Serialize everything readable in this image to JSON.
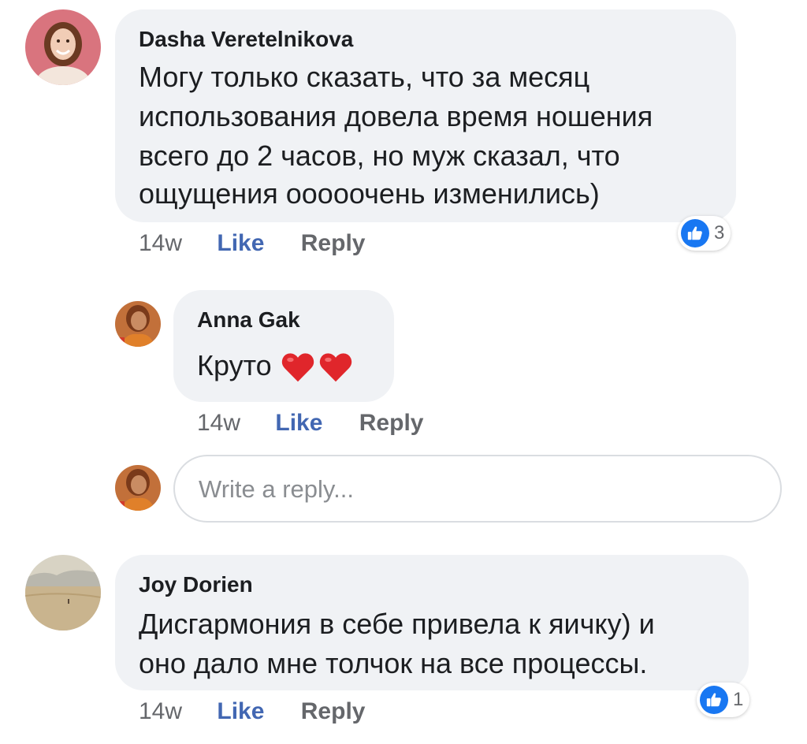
{
  "comments": [
    {
      "author": "Dasha Veretelnikova",
      "lines": [
        "Могу только сказать, что за месяц",
        "использования довела время ношения",
        "всего до 2 часов, но муж сказал, что",
        "ощущения ооооочень изменились)"
      ],
      "time": "14w",
      "like_label": "Like",
      "reply_label": "Reply",
      "reaction_icon": "thumbs-up-icon",
      "reaction_count": "3",
      "avatar_colors": {
        "bg": "#d9747e",
        "skin": "#f1cdb6",
        "hair": "#6b3a22"
      }
    },
    {
      "author": "Anna Gak",
      "text": "Круто",
      "emoji": [
        "heart-emoji",
        "heart-emoji"
      ],
      "time": "14w",
      "like_label": "Like",
      "reply_label": "Reply",
      "avatar_colors": {
        "bg": "#c2703a",
        "skin": "#c98c63",
        "scarf": "#e0802a"
      }
    },
    {
      "author": "Joy Dorien",
      "lines": [
        "Дисгармония в себе привела к яичку) и",
        "оно дало мне толчок на все процессы."
      ],
      "time": "14w",
      "like_label": "Like",
      "reply_label": "Reply",
      "reaction_icon": "thumbs-up-icon",
      "reaction_count": "1",
      "avatar_colors": {
        "sky": "#d8d3c4",
        "ground": "#c9b48e"
      }
    }
  ],
  "reply_input": {
    "placeholder": "Write a reply..."
  },
  "colors": {
    "bubble": "#f0f2f5",
    "link_blue": "#4267b2",
    "meta_gray": "#65676b",
    "reaction_blue": "#1877f2",
    "heart_red": "#e0262b"
  }
}
